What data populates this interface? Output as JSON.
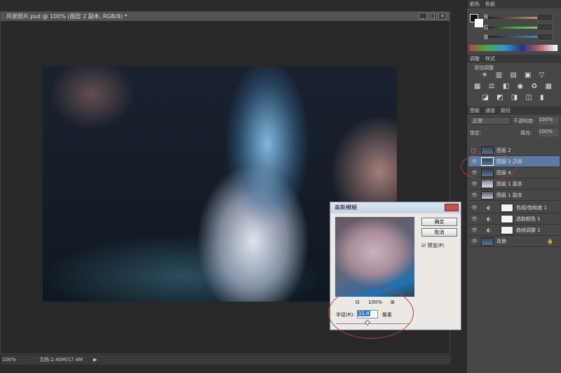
{
  "document": {
    "title": "风景照片.psd @ 100% (图层 2 副本, RGB/8) *",
    "minimize": "_",
    "maximize": "□",
    "close": "×"
  },
  "status": {
    "zoom": "100%",
    "doc_info": "文档:2.40M/17.4M",
    "arrow": "▶"
  },
  "dialog": {
    "title": "高斯模糊",
    "ok": "确定",
    "cancel": "取消",
    "preview": "☑ 预览(P)",
    "zoom_out": "⊟",
    "zoom_level": "100%",
    "zoom_in": "⊞",
    "radius_label": "半径(R):",
    "radius_value": "11.4",
    "unit": "像素"
  },
  "color_panel": {
    "tabs": [
      "颜色",
      "色板"
    ],
    "channels": [
      "R",
      "G",
      "B"
    ]
  },
  "adjustments_panel": {
    "tabs": [
      "调整",
      "样式"
    ],
    "subtitle": "添加调整",
    "icons_row1": "☀ ▥ ▤ ▣ ▽",
    "icons_row2": "▦ ⚖ ◧ ◉ ♻ ▦",
    "icons_row3": "◪ ◩ ◨ ◫ ▮"
  },
  "layers_panel": {
    "tabs": [
      "图层",
      "通道",
      "路径"
    ],
    "blend_mode": "正常",
    "opacity_label": "不透明度:",
    "opacity": "100%",
    "lock_label": "锁定:",
    "fill_label": "填充:",
    "fill": "100%",
    "layers": [
      {
        "name": "图层 2",
        "visible": false
      },
      {
        "name": "图层 2 副本",
        "visible": true,
        "selected": true
      },
      {
        "name": "图层 4",
        "visible": true
      },
      {
        "name": "图层 1 副本",
        "visible": true
      },
      {
        "name": "图层 1 副本",
        "visible": true
      },
      {
        "name": "色相/饱和度 1",
        "visible": true,
        "adjustment": true
      },
      {
        "name": "选取颜色 1",
        "visible": true,
        "adjustment": true
      },
      {
        "name": "曲线调整 1",
        "visible": true,
        "adjustment": true
      },
      {
        "name": "背景",
        "visible": true,
        "locked": true
      }
    ]
  },
  "colors": {
    "accent": "#5a7ca4",
    "annotation": "#b04040"
  }
}
